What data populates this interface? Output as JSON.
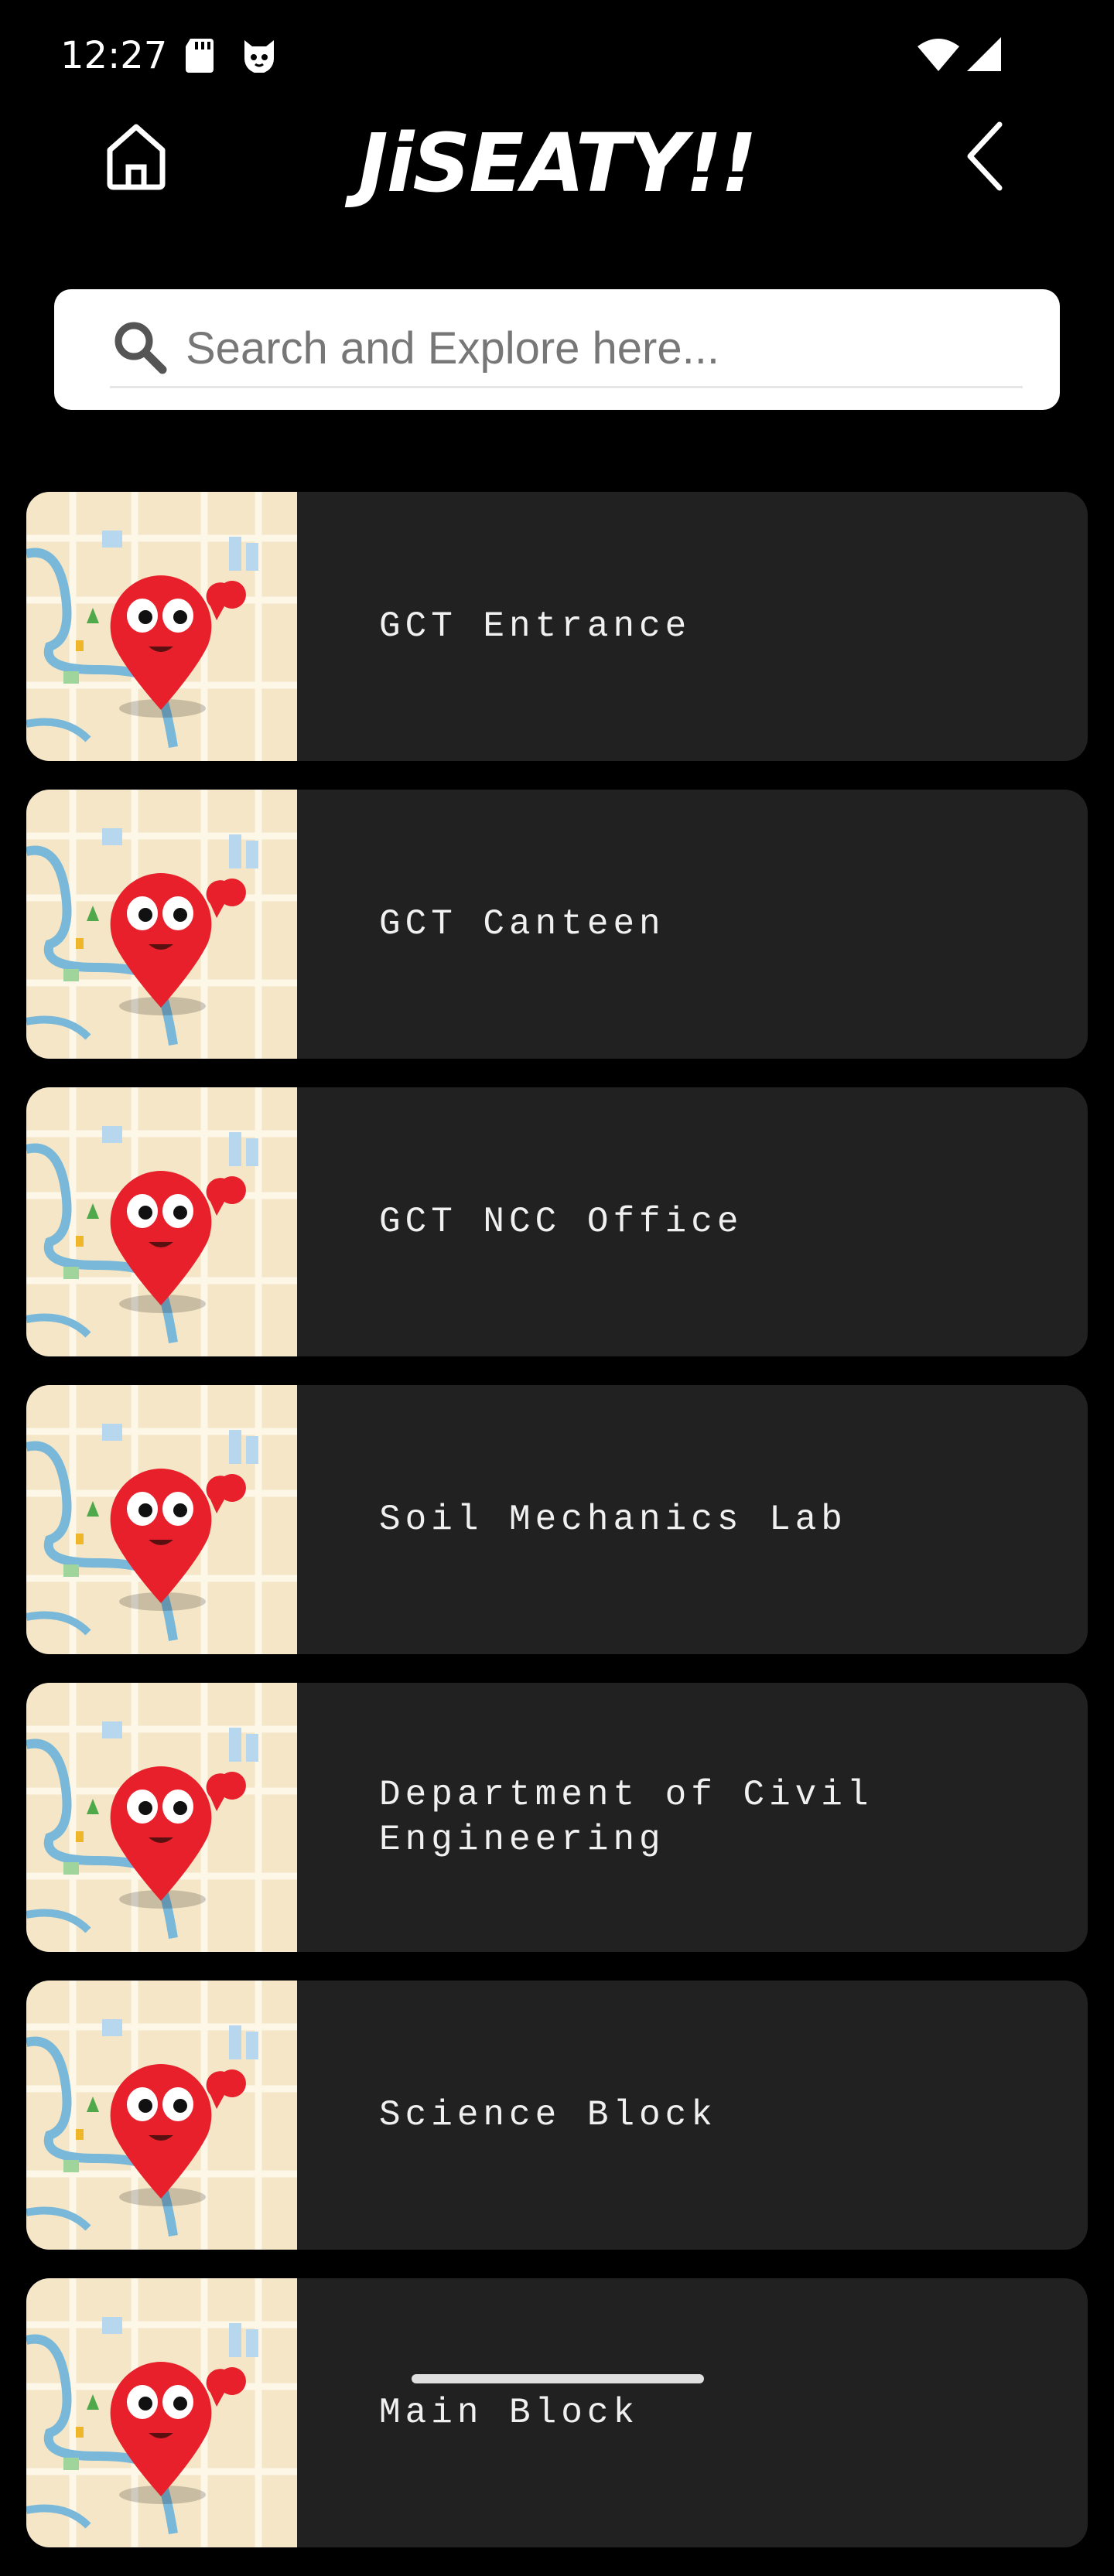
{
  "status": {
    "time": "12:27"
  },
  "appbar": {
    "title": "JiSEATY!!"
  },
  "search": {
    "placeholder": "Search and Explore here..."
  },
  "places": [
    {
      "label": "GCT Entrance"
    },
    {
      "label": "GCT Canteen"
    },
    {
      "label": "GCT NCC Office"
    },
    {
      "label": "Soil Mechanics Lab"
    },
    {
      "label": "Department of Civil\nEngineering"
    },
    {
      "label": "Science Block"
    },
    {
      "label": "Main Block"
    }
  ],
  "colors": {
    "background": "#000000",
    "card": "#212121",
    "pin": "#e8202b",
    "map": "#f4e6c6",
    "river": "#7ab8d9"
  },
  "icons": [
    "sd-card-icon",
    "cat-icon",
    "wifi-icon",
    "signal-icon",
    "home-icon",
    "chevron-left-icon",
    "search-icon",
    "map-pin-icon"
  ]
}
